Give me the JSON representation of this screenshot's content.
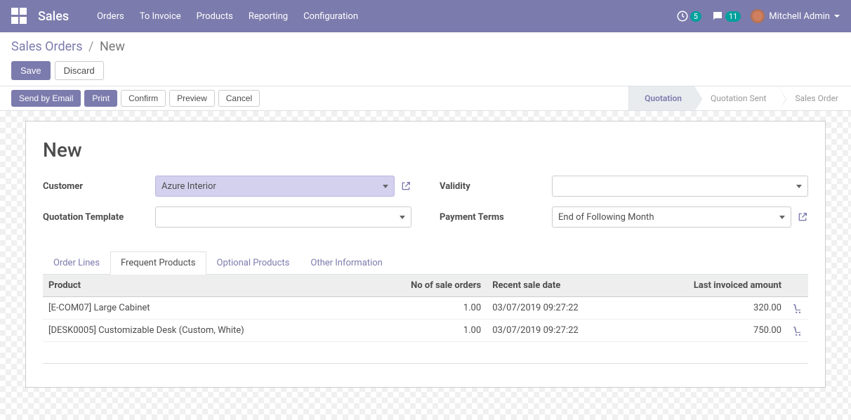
{
  "navbar": {
    "brand": "Sales",
    "menu": [
      "Orders",
      "To Invoice",
      "Products",
      "Reporting",
      "Configuration"
    ],
    "clock_badge": "5",
    "msg_badge": "11",
    "user": "Mitchell Admin"
  },
  "breadcrumb": {
    "root": "Sales Orders",
    "current": "New",
    "save": "Save",
    "discard": "Discard"
  },
  "actions": {
    "send_email": "Send by Email",
    "print": "Print",
    "confirm": "Confirm",
    "preview": "Preview",
    "cancel": "Cancel"
  },
  "status": [
    "Quotation",
    "Quotation Sent",
    "Sales Order"
  ],
  "form": {
    "title": "New",
    "customer_label": "Customer",
    "customer_value": "Azure Interior",
    "template_label": "Quotation Template",
    "template_value": "",
    "validity_label": "Validity",
    "validity_value": "",
    "payment_label": "Payment Terms",
    "payment_value": "End of Following Month"
  },
  "tabs": [
    "Order Lines",
    "Frequent Products",
    "Optional Products",
    "Other Information"
  ],
  "table": {
    "headers": {
      "product": "Product",
      "orders": "No of sale orders",
      "date": "Recent sale date",
      "amount": "Last invoiced amount"
    },
    "rows": [
      {
        "product": "[E-COM07] Large Cabinet",
        "orders": "1.00",
        "date": "03/07/2019 09:27:22",
        "amount": "320.00"
      },
      {
        "product": "[DESK0005] Customizable Desk (Custom, White)",
        "orders": "1.00",
        "date": "03/07/2019 09:27:22",
        "amount": "750.00"
      }
    ]
  }
}
